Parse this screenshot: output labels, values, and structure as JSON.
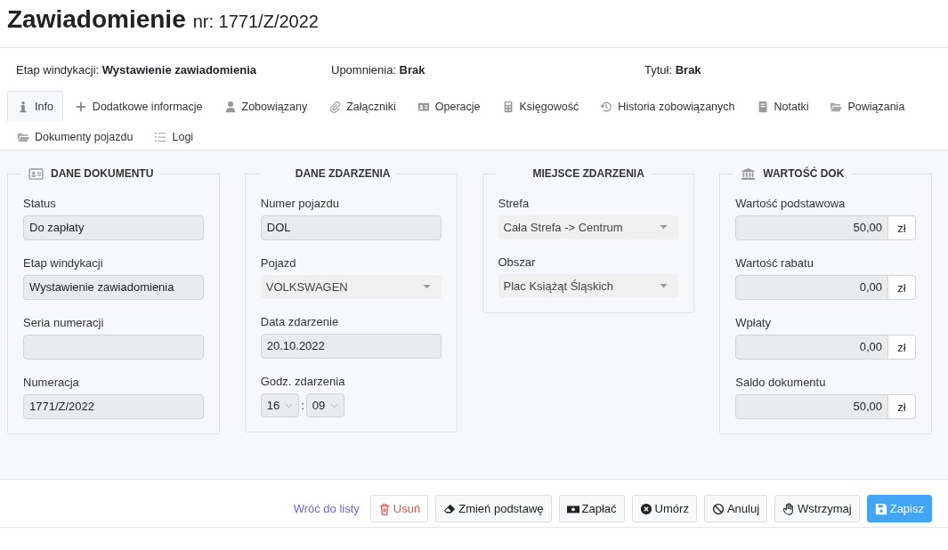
{
  "header": {
    "title": "Zawiadomienie",
    "subtitle": "nr: 1771/Z/2022"
  },
  "info": [
    {
      "label": "Etap windykacji:",
      "value": "Wystawienie zawiadomienia"
    },
    {
      "label": "Upomnienia:",
      "value": "Brak"
    },
    {
      "label": "Tytuł:",
      "value": "Brak"
    }
  ],
  "tabs": [
    {
      "label": "Info",
      "selected": true
    },
    {
      "label": "Dodatkowe informacje",
      "selected": false
    },
    {
      "label": "Zobowiązany",
      "selected": false
    },
    {
      "label": "Załączniki",
      "selected": false
    },
    {
      "label": "Operacje",
      "selected": false
    },
    {
      "label": "Księgowość",
      "selected": false
    },
    {
      "label": "Historia zobowiązanych",
      "selected": false
    },
    {
      "label": "Notatki",
      "selected": false
    },
    {
      "label": "Powiązania",
      "selected": false
    },
    {
      "label": "Dokumenty pojazdu",
      "selected": false
    },
    {
      "label": "Logi",
      "selected": false
    }
  ],
  "panels": [
    {
      "title": "DANE DOKUMENTU",
      "fields": [
        {
          "kind": "input",
          "label": "Status",
          "value": "Do zapłaty"
        },
        {
          "kind": "input",
          "label": "Etap windykacji",
          "value": "Wystawienie zawiadomienia"
        },
        {
          "kind": "input",
          "label": "Seria numeracji"
        },
        {
          "kind": "input",
          "label": "Numeracja",
          "value": "1771/Z/2022"
        }
      ]
    },
    {
      "title": "DANE ZDARZENIA",
      "fields": [
        {
          "kind": "input",
          "label": "Numer pojazdu",
          "value": "DOL"
        },
        {
          "kind": "select",
          "label": "Pojazd",
          "value": "VOLKSWAGEN"
        },
        {
          "kind": "input",
          "label": "Data zdarzenie",
          "value": "20.10.2022"
        },
        {
          "kind": "time",
          "label": "Godz. zdarzenia",
          "hour": "16",
          "separator": ":",
          "minute": "09"
        }
      ]
    },
    {
      "title": "MIEJSCE ZDARZENIA",
      "fields": [
        {
          "kind": "select",
          "label": "Strefa",
          "value": "Cała Strefa -> Centrum"
        },
        {
          "kind": "select",
          "label": "Obszar",
          "value": "Plac Książąt Śląskich"
        }
      ]
    },
    {
      "title": "WARTOŚĆ DOK",
      "fields": [
        {
          "kind": "money",
          "label": "Wartość podstawowa",
          "value": "50,00",
          "unit": "zł"
        },
        {
          "kind": "money",
          "label": "Wartość rabatu",
          "value": "0,00",
          "unit": "zł"
        },
        {
          "kind": "money",
          "label": "Wpłaty",
          "value": "0,00",
          "unit": "zł"
        },
        {
          "kind": "money",
          "label": "Saldo dokumentu",
          "value": "50,00",
          "unit": "zł"
        }
      ]
    }
  ],
  "actions": [
    {
      "kind": "link",
      "label": "Wróć do listy"
    },
    {
      "kind": "danger",
      "label": "Usuń"
    },
    {
      "kind": "default",
      "label": "Zmień podstawę"
    },
    {
      "kind": "default",
      "label": "Zapłać"
    },
    {
      "kind": "default",
      "label": "Umórz"
    },
    {
      "kind": "default",
      "label": "Anuluj"
    },
    {
      "kind": "default",
      "label": "Wstrzymaj"
    },
    {
      "kind": "primary",
      "label": "Zapisz"
    }
  ]
}
